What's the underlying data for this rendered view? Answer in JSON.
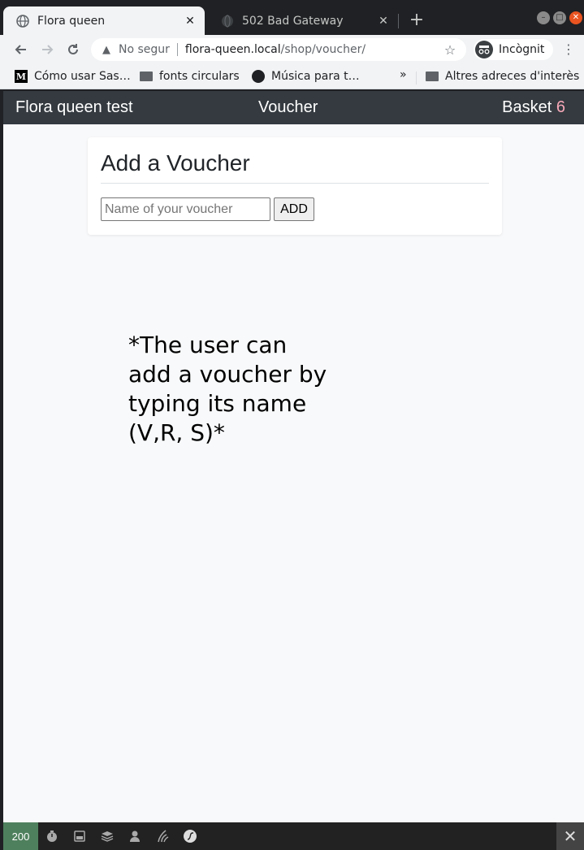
{
  "browser": {
    "tabs": [
      {
        "title": "Flora queen",
        "active": true
      },
      {
        "title": "502 Bad Gateway",
        "active": false
      }
    ],
    "new_tab_symbol": "+",
    "address": {
      "security_label": "No segur",
      "host": "flora-queen.local",
      "path": "/shop/voucher/"
    },
    "profile_label": "Incògnit",
    "bookmarks": [
      {
        "label": "Cómo usar Sas…",
        "icon": "medium-icon"
      },
      {
        "label": "fonts circulars",
        "icon": "folder-icon"
      },
      {
        "label": "Música para t…",
        "icon": "spotify-icon"
      }
    ],
    "bookmarks_overflow": "»",
    "other_bookmarks": "Altres adreces d'interès"
  },
  "app": {
    "nav": {
      "brand": "Flora queen test",
      "center": "Voucher",
      "basket_label": "Basket",
      "basket_count": "6"
    },
    "voucher_card": {
      "title": "Add a Voucher",
      "input_placeholder": "Name of your voucher",
      "input_value": "",
      "add_label": "ADD"
    },
    "note": "*The user can add a voucher by typing its name (V,R, S)*"
  },
  "debug_toolbar": {
    "status_code": "200"
  },
  "colors": {
    "app_nav_bg": "#343a40",
    "basket_count": "#f7a8b8",
    "status_ok": "#4f805d",
    "page_bg": "#f8f9fa"
  }
}
